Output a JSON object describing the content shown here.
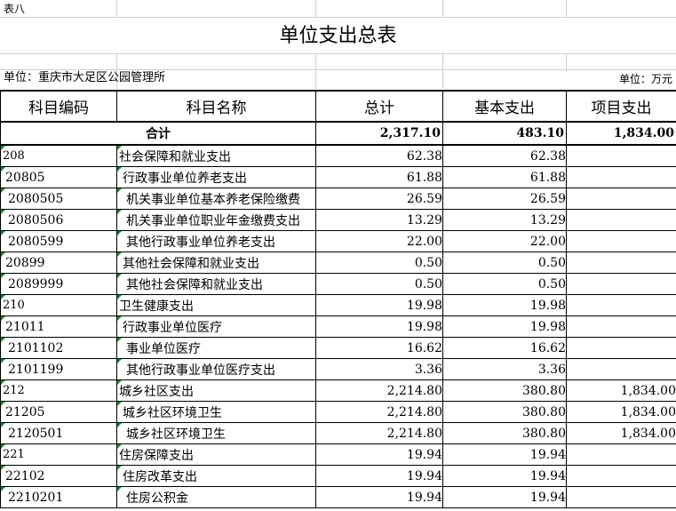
{
  "sheet": {
    "label": "表八",
    "title": "单位支出总表",
    "unit_org": "单位：重庆市大足区公园管理所",
    "unit_money": "单位：万元"
  },
  "headers": {
    "code": "科目编码",
    "name": "科目名称",
    "total": "总计",
    "basic": "基本支出",
    "project": "项目支出"
  },
  "summary": {
    "label": "合计",
    "total": "2,317.10",
    "basic": "483.10",
    "project": "1,834.00"
  },
  "rows": [
    {
      "code": "208",
      "name": "社会保障和就业支出",
      "total": "62.38",
      "basic": "62.38",
      "project": ""
    },
    {
      "code": "20805",
      "name": "行政事业单位养老支出",
      "total": "61.88",
      "basic": "61.88",
      "project": ""
    },
    {
      "code": "2080505",
      "name": "机关事业单位基本养老保险缴费",
      "total": "26.59",
      "basic": "26.59",
      "project": ""
    },
    {
      "code": "2080506",
      "name": "机关事业单位职业年金缴费支出",
      "total": "13.29",
      "basic": "13.29",
      "project": ""
    },
    {
      "code": "2080599",
      "name": "其他行政事业单位养老支出",
      "total": "22.00",
      "basic": "22.00",
      "project": ""
    },
    {
      "code": "20899",
      "name": "其他社会保障和就业支出",
      "total": "0.50",
      "basic": "0.50",
      "project": ""
    },
    {
      "code": "2089999",
      "name": "其他社会保障和就业支出",
      "total": "0.50",
      "basic": "0.50",
      "project": ""
    },
    {
      "code": "210",
      "name": "卫生健康支出",
      "total": "19.98",
      "basic": "19.98",
      "project": ""
    },
    {
      "code": "21011",
      "name": "行政事业单位医疗",
      "total": "19.98",
      "basic": "19.98",
      "project": ""
    },
    {
      "code": "2101102",
      "name": "事业单位医疗",
      "total": "16.62",
      "basic": "16.62",
      "project": ""
    },
    {
      "code": "2101199",
      "name": "其他行政事业单位医疗支出",
      "total": "3.36",
      "basic": "3.36",
      "project": ""
    },
    {
      "code": "212",
      "name": "城乡社区支出",
      "total": "2,214.80",
      "basic": "380.80",
      "project": "1,834.00"
    },
    {
      "code": "21205",
      "name": "城乡社区环境卫生",
      "total": "2,214.80",
      "basic": "380.80",
      "project": "1,834.00"
    },
    {
      "code": "2120501",
      "name": "城乡社区环境卫生",
      "total": "2,214.80",
      "basic": "380.80",
      "project": "1,834.00"
    },
    {
      "code": "221",
      "name": "住房保障支出",
      "total": "19.94",
      "basic": "19.94",
      "project": ""
    },
    {
      "code": "22102",
      "name": "住房改革支出",
      "total": "19.94",
      "basic": "19.94",
      "project": ""
    },
    {
      "code": "2210201",
      "name": "住房公积金",
      "total": "19.94",
      "basic": "19.94",
      "project": ""
    }
  ]
}
